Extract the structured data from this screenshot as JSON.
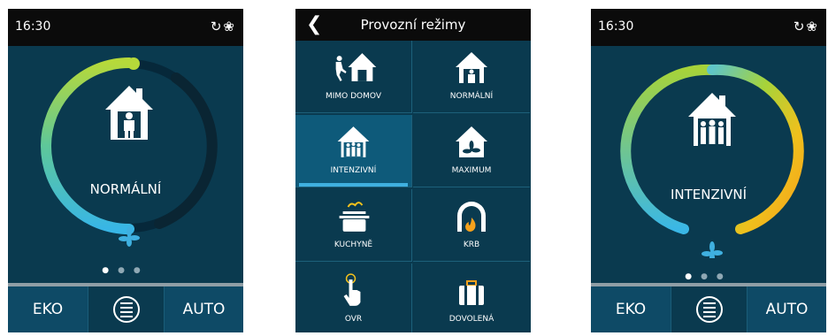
{
  "screen_left": {
    "time": "16:30",
    "status_icons": [
      "refresh-icon",
      "fan-icon"
    ],
    "mode_label": "NORMÁLNÍ",
    "buttons": {
      "left": "EKO",
      "right": "AUTO",
      "middle_icon": "menu-icon"
    },
    "page_dots": {
      "active": 1,
      "total": 3
    }
  },
  "screen_middle": {
    "title": "Provozní režimy",
    "tiles": [
      {
        "label": "MIMO DOMOV",
        "icon": "away-home-icon"
      },
      {
        "label": "NORMÁLNÍ",
        "icon": "normal-home-icon"
      },
      {
        "label": "INTENZIVNÍ",
        "icon": "intensive-home-icon",
        "active": true
      },
      {
        "label": "MAXIMUM",
        "icon": "maximum-fan-home-icon"
      },
      {
        "label": "KUCHYNĚ",
        "icon": "cooking-pot-icon"
      },
      {
        "label": "KRB",
        "icon": "fireplace-icon"
      },
      {
        "label": "OVR",
        "icon": "touch-hand-icon"
      },
      {
        "label": "DOVOLENÁ",
        "icon": "suitcase-icon"
      }
    ]
  },
  "screen_right": {
    "time": "16:30",
    "status_icons": [
      "refresh-icon",
      "fan-icon"
    ],
    "mode_label": "INTENZIVNÍ",
    "buttons": {
      "left": "EKO",
      "right": "AUTO",
      "middle_icon": "menu-icon"
    },
    "page_dots": {
      "active": 1,
      "total": 3
    }
  },
  "colors": {
    "background": "#0a3a4f",
    "status_bar": "#0b0b0b",
    "accent_blue": "#3fb0e0",
    "ring_green": "#9bd43a",
    "ring_yellow": "#f5b51c"
  }
}
